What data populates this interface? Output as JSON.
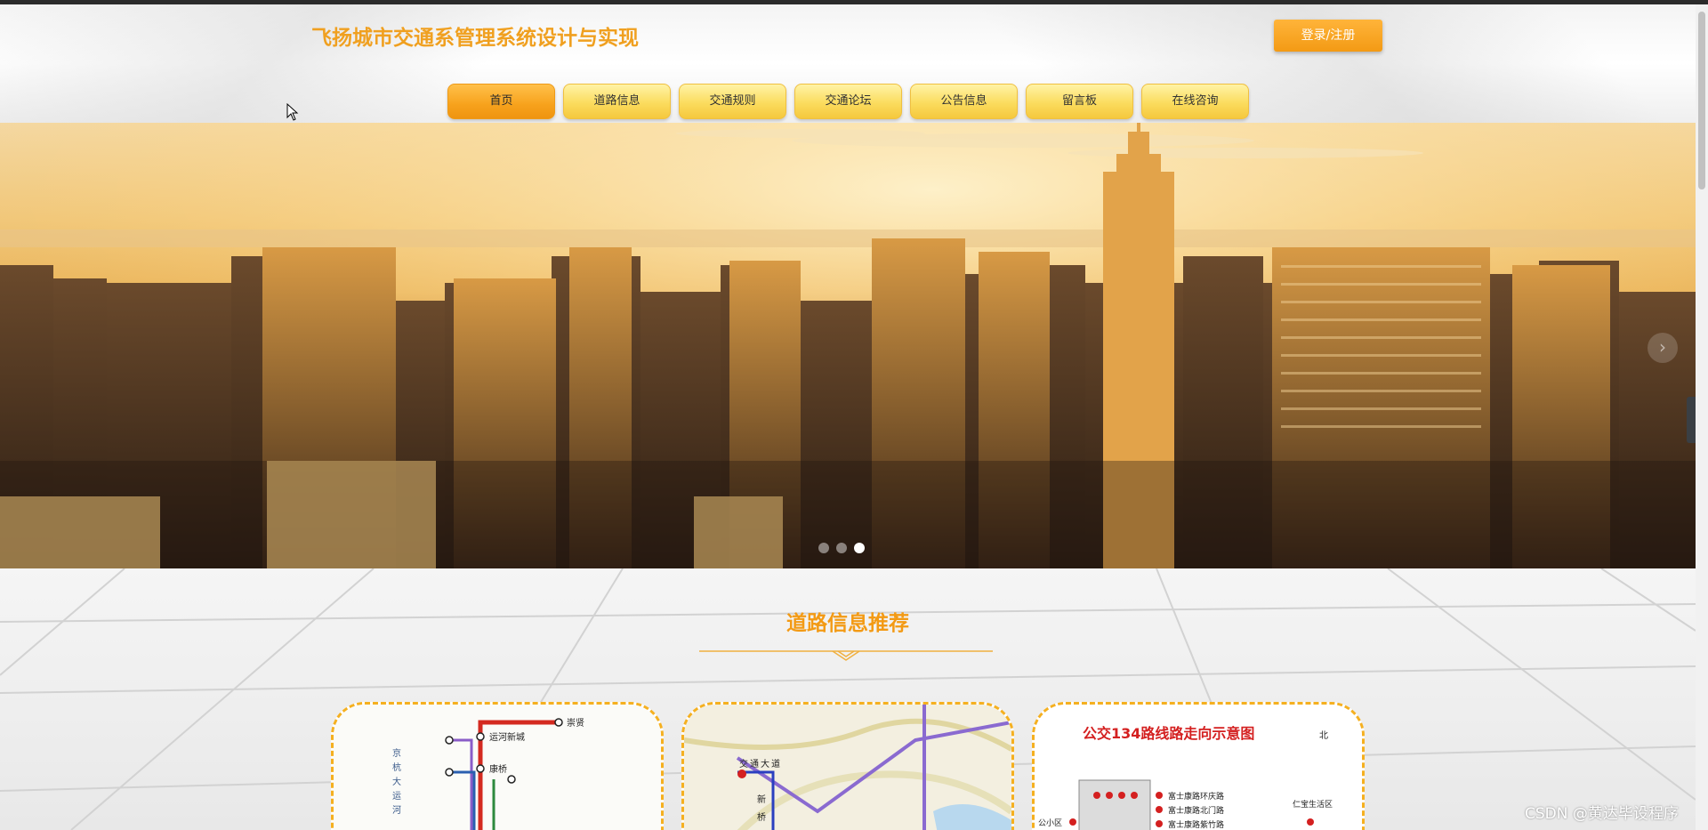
{
  "header": {
    "site_title": "飞扬城市交通系管理系统设计与实现",
    "login_label": "登录/注册"
  },
  "nav": {
    "items": [
      "首页",
      "道路信息",
      "交通规则",
      "交通论坛",
      "公告信息",
      "留言板",
      "在线咨询"
    ],
    "active": "首页"
  },
  "banner": {
    "slide_count": 3,
    "active_slide": 3,
    "next_icon": "chevron-right-icon"
  },
  "section": {
    "title": "道路信息推荐",
    "cards": [
      {
        "map_labels": [
          "崇贤",
          "运河新城",
          "京",
          "杭",
          "大",
          "运",
          "河",
          "康桥"
        ]
      },
      {
        "map_labels": [
          "交",
          "通",
          "大",
          "道",
          "新",
          "桥"
        ]
      },
      {
        "title": "公交134路线路走向示意图",
        "direction": "北",
        "map_labels": [
          "富士康路环庆路",
          "富士康路北门路",
          "富士康路紫竹路",
          "仁宝生活区",
          "公小区"
        ]
      }
    ]
  },
  "side_tab_icon": "chevron-left-icon",
  "watermark": "CSDN @黄达毕设程序",
  "colors": {
    "accent": "#f39a14",
    "nav_bg": "#fbdc5e",
    "title": "#f0a020"
  }
}
